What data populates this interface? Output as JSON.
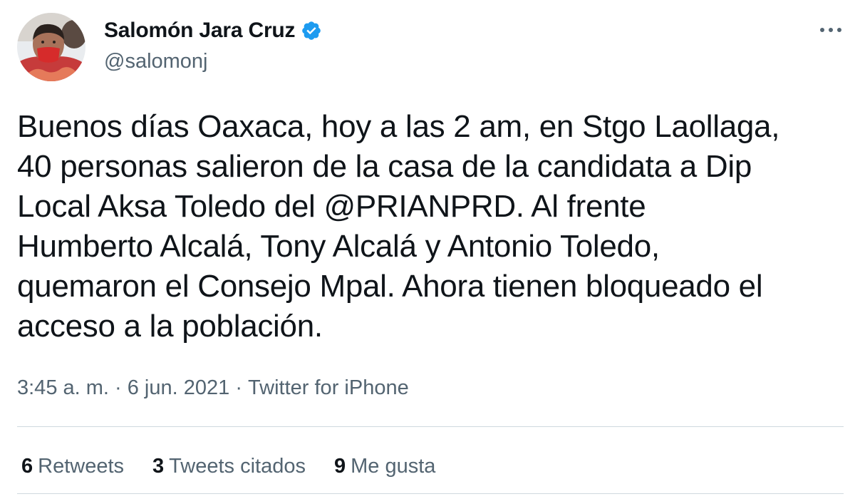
{
  "author": {
    "display_name": "Salomón Jara Cruz",
    "handle": "@salomonj",
    "verified_icon": "verified-badge-icon",
    "verified_color": "#1d9bf0"
  },
  "tweet": {
    "text": "Buenos días Oaxaca, hoy a las 2 am, en Stgo Laollaga,\n40 personas salieron de la casa de la candidata a Dip\nLocal Aksa Toledo del @PRIANPRD.  Al frente\nHumberto Alcalá, Tony Alcalá y Antonio Toledo,\nquemaron el Consejo Mpal. Ahora tienen bloqueado el\nacceso a la población."
  },
  "meta": {
    "time": "3:45 a. m.",
    "sep1": " · ",
    "date": "6 jun. 2021",
    "sep2": " · ",
    "source": "Twitter for iPhone"
  },
  "stats": {
    "retweets_count": "6",
    "retweets_label": "Retweets",
    "quotes_count": "3",
    "quotes_label": "Tweets citados",
    "likes_count": "9",
    "likes_label": "Me gusta"
  },
  "colors": {
    "text": "#0f1419",
    "secondary": "#536471",
    "divider": "#cfd9de"
  }
}
